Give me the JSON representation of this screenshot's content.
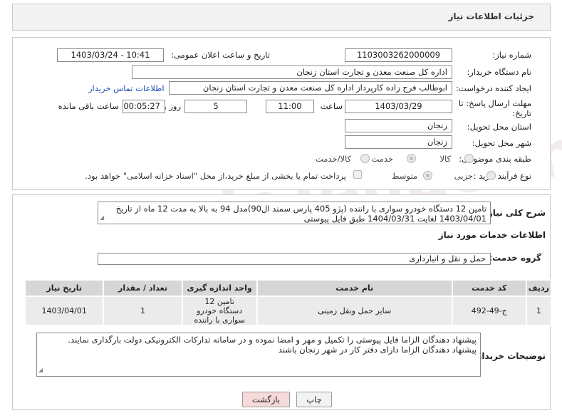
{
  "header": {
    "title": "جزئیات اطلاعات نیاز"
  },
  "form": {
    "need_number_label": "شماره نیاز:",
    "need_number": "1103003262000009",
    "announce_label": "تاریخ و ساعت اعلان عمومی:",
    "announce_value": "1403/03/24 - 10:41",
    "buyer_org_label": "نام دستگاه خریدار:",
    "buyer_org": "اداره کل صنعت  معدن و تجارت استان زنجان",
    "creator_label": "ایجاد کننده درخواست:",
    "creator": "ابوطالب فرج زاده کارپرداز اداره کل صنعت  معدن و تجارت استان زنجان",
    "contact_link": "اطلاعات تماس خریدار",
    "deadline_label_1": "مهلت ارسال پاسخ: تا",
    "deadline_label_2": "تاریخ:",
    "deadline_date": "1403/03/29",
    "time_label": "ساعت",
    "deadline_time": "11:00",
    "days_value": "5",
    "days_label": "روز و",
    "remaining_value": "00:05:27",
    "remaining_label": "ساعت باقی مانده",
    "province_label": "استان محل تحویل:",
    "province": "زنجان",
    "city_label": "شهر محل تحویل:",
    "city": "زنجان",
    "category_label": "طبقه بندی موضوعی:",
    "category_options": [
      "کالا",
      "خدمت",
      "کالا/خدمت"
    ],
    "process_label": "نوع فرآیند خرید :",
    "process_options": [
      "جزیی",
      "متوسط"
    ],
    "payment_note": "پرداخت تمام یا بخشی از مبلغ خرید،از محل \"اسناد خزانه اسلامی\" خواهد بود."
  },
  "summary": {
    "label": "شرح کلی نیاز:",
    "text": "تامین 12 دستگاه خودرو سواری با راننده (پژو 405 پارس سمند ال90)مدل 94 به بالا  به مدت 12 ماه از تاریخ 1403/04/01 لغایت 1404/03/31 طبق فایل پیوستی"
  },
  "services": {
    "section_title": "اطلاعات خدمات مورد نیاز",
    "group_label": "گروه خدمت:",
    "group_value": "حمل و نقل و انبارداری",
    "columns": [
      "ردیف",
      "کد خدمت",
      "نام خدمت",
      "واحد اندازه گیری",
      "تعداد / مقدار",
      "تاریخ نیاز"
    ],
    "rows": [
      {
        "row": "1",
        "code": "ج-49-492",
        "name": "سایر حمل ونقل زمینی",
        "unit": "تامین 12 دستگاه خودرو سواری با راننده",
        "qty": "1",
        "date": "1403/04/01"
      }
    ]
  },
  "buyer_notes": {
    "label": "توضیحات خریدار:",
    "line1": "پیشنهاد دهندگان الزاما فایل پیوستی را تکمیل و مهر و امضا نموده و در سامانه تدارکات الکترونیکی دولت بارگذاری نمایند.",
    "line2": "پیشنهاد دهندگان الزاما دارای دفتر کار در شهر زنجان باشند"
  },
  "buttons": {
    "print": "چاپ",
    "back": "بازگشت"
  },
  "watermark": "AriaTender.neT",
  "colors": {
    "link": "#1c4fb3",
    "back_button": "#f6d9d9",
    "header_bg": "#f3f3f3"
  }
}
